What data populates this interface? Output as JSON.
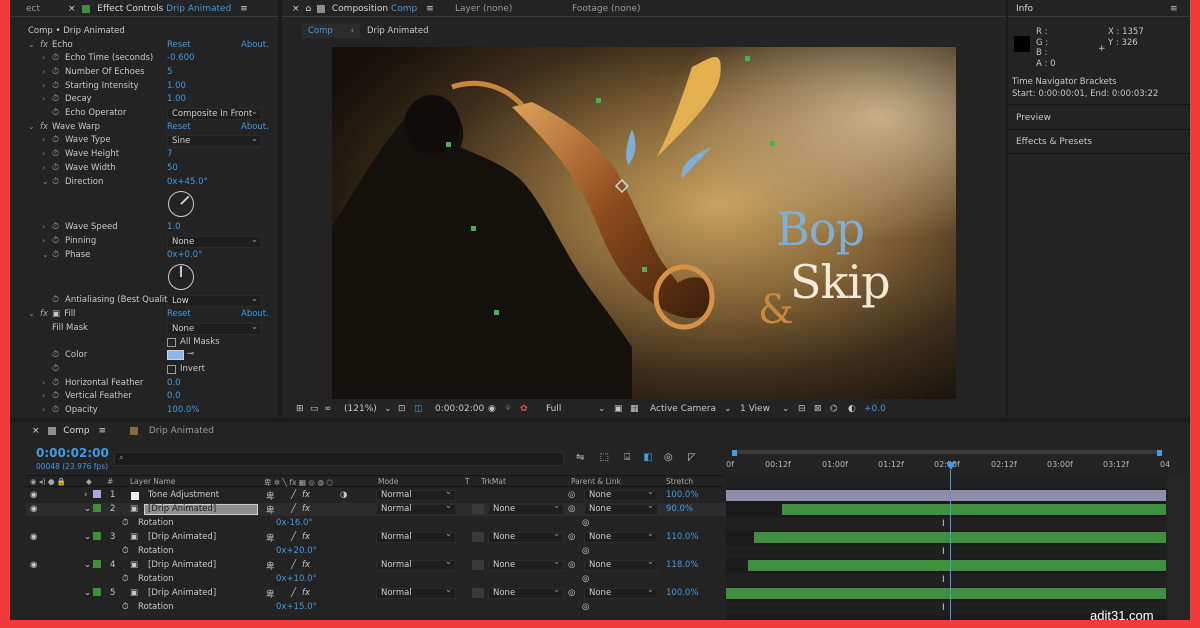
{
  "watermark": "adit31.com",
  "effect_controls": {
    "tab_prefix": "ect",
    "tab_title": "Effect Controls",
    "tab_layer": "Drip Animated",
    "breadcrumb": "Comp • Drip Animated",
    "echo": {
      "name": "Echo",
      "reset": "Reset",
      "about": "About.",
      "props": [
        {
          "name": "Echo Time (seconds)",
          "value": "-0.600"
        },
        {
          "name": "Number Of Echoes",
          "value": "5"
        },
        {
          "name": "Starting Intensity",
          "value": "1.00"
        },
        {
          "name": "Decay",
          "value": "1.00"
        },
        {
          "name": "Echo Operator",
          "value": "Composite In Front"
        }
      ]
    },
    "wave_warp": {
      "name": "Wave Warp",
      "reset": "Reset",
      "about": "About.",
      "props": [
        {
          "name": "Wave Type",
          "value": "Sine"
        },
        {
          "name": "Wave Height",
          "value": "7"
        },
        {
          "name": "Wave Width",
          "value": "50"
        },
        {
          "name": "Direction",
          "value": "0x+45.0°"
        },
        {
          "name": "Wave Speed",
          "value": "1.0"
        },
        {
          "name": "Pinning",
          "value": "None"
        },
        {
          "name": "Phase",
          "value": "0x+0.0°"
        },
        {
          "name": "Antialiasing (Best Qualit",
          "value": "Low"
        }
      ]
    },
    "fill": {
      "name": "Fill",
      "reset": "Reset",
      "about": "About.",
      "fill_mask_label": "Fill Mask",
      "fill_mask_value": "None",
      "all_masks": "All Masks",
      "color_label": "Color",
      "invert": "Invert",
      "horizontal_feather": "Horizontal Feather",
      "horizontal_feather_value": "0.0",
      "vertical_feather": "Vertical Feather",
      "vertical_feather_value": "0.0",
      "opacity": "Opacity",
      "opacity_value": "100.0%"
    }
  },
  "composition": {
    "tab_title": "Composition",
    "tab_name": "Comp",
    "layer_tab": "Layer (none)",
    "footage_tab": "Footage (none)",
    "crumb_comp": "Comp",
    "crumb_layer": "Drip Animated",
    "artwork": {
      "word1": "Bop",
      "amp": "&",
      "word2": "Skip"
    },
    "viewer_bar": {
      "zoom": "(121%)",
      "timecode": "0:00:02:00",
      "resolution": "Full",
      "camera": "Active Camera",
      "views": "1 View",
      "exposure": "+0.0"
    }
  },
  "info": {
    "title": "Info",
    "r": "R :",
    "g": "G :",
    "b": "B :",
    "a": "A :  0",
    "x": "X : 1357",
    "y": "Y :  326",
    "nav_title": "Time Navigator Brackets",
    "nav_range": "Start: 0:00:00:01, End: 0:00:03:22",
    "preview": "Preview",
    "effects_presets": "Effects & Presets"
  },
  "timeline": {
    "tab_comp": "Comp",
    "tab_drip": "Drip Animated",
    "timecode": "0:00:02:00",
    "frames": "00048 (23.976 fps)",
    "search_placeholder": "",
    "columns": {
      "layer_name": "Layer Name",
      "mode": "Mode",
      "t": "T",
      "trkmat": "TrkMat",
      "parent": "Parent & Link",
      "stretch": "Stretch"
    },
    "ruler": [
      "0f",
      "00:12f",
      "01:00f",
      "01:12f",
      "02:00f",
      "02:12f",
      "03:00f",
      "03:12f",
      "04"
    ],
    "layers": [
      {
        "num": "1",
        "name": "Tone Adjustment",
        "mode": "Normal",
        "trkmat": "",
        "parent": "None",
        "stretch": "100.0%",
        "color": "#a6a6e0",
        "sub_name": "",
        "sub_value": ""
      },
      {
        "num": "2",
        "name": "[Drip Animated]",
        "mode": "Normal",
        "trkmat": "None",
        "parent": "None",
        "stretch": "90.0%",
        "color": "#3f8f3e",
        "sub_name": "Rotation",
        "sub_value": "0x-16.0°"
      },
      {
        "num": "3",
        "name": "[Drip Animated]",
        "mode": "Normal",
        "trkmat": "None",
        "parent": "None",
        "stretch": "110.0%",
        "color": "#3f8f3e",
        "sub_name": "Rotation",
        "sub_value": "0x+20.0°"
      },
      {
        "num": "4",
        "name": "[Drip Animated]",
        "mode": "Normal",
        "trkmat": "None",
        "parent": "None",
        "stretch": "118.0%",
        "color": "#3f8f3e",
        "sub_name": "Rotation",
        "sub_value": "0x+10.0°"
      },
      {
        "num": "5",
        "name": "[Drip Animated]",
        "mode": "Normal",
        "trkmat": "None",
        "parent": "None",
        "stretch": "100.0%",
        "color": "#3f8f3e",
        "sub_name": "Rotation",
        "sub_value": "0x+15.0°"
      }
    ],
    "colors": {
      "accent": "#3f9be6",
      "track": "#3f8f3e",
      "adjustment": "#8e8ea8"
    }
  }
}
